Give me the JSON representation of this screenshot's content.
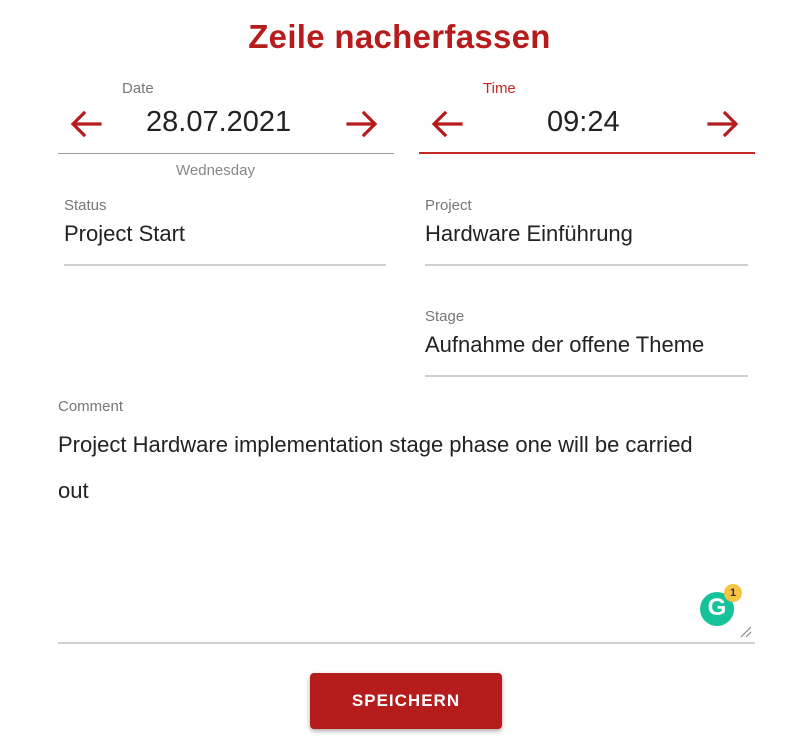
{
  "title": "Zeile nacherfassen",
  "date": {
    "label": "Date",
    "value": "28.07.2021",
    "weekday": "Wednesday"
  },
  "time": {
    "label": "Time",
    "value": "09:24"
  },
  "status": {
    "label": "Status",
    "value": "Project Start"
  },
  "project": {
    "label": "Project",
    "value": "Hardware Einführung"
  },
  "stage": {
    "label": "Stage",
    "value": "Aufnahme der offene Theme"
  },
  "comment": {
    "label": "Comment",
    "value": "Project Hardware implementation stage phase one will be carried out"
  },
  "grammarly": {
    "badge_count": "1"
  },
  "save_button": {
    "label": "SPEICHERN"
  },
  "colors": {
    "accent": "#b71c1c",
    "grammarly": "#15c39a"
  },
  "icons": {
    "prev": "arrow-left-icon",
    "next": "arrow-right-icon"
  }
}
